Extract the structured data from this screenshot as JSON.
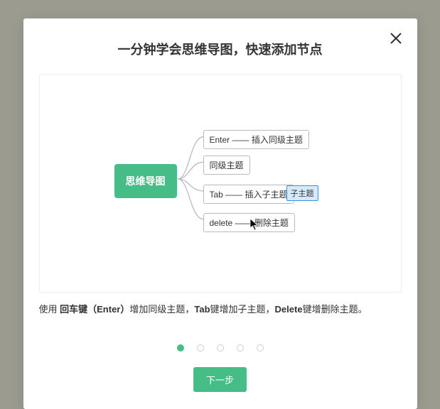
{
  "dialog": {
    "title": "一分钟学会思维导图，快速添加节点"
  },
  "mindmap": {
    "root": "思维导图",
    "children": [
      "Enter —— 插入同级主题",
      "同级主题",
      "Tab —— 插入子主题",
      "delete —— 删除主题"
    ],
    "sub": "子主题"
  },
  "caption": {
    "t1": "使用 ",
    "b1": "回车键（Enter）",
    "t2": "增加同级主题，",
    "b2": "Tab",
    "t3": "键增加子主题，",
    "b3": "Delete",
    "t4": "键增删除主题。"
  },
  "footer": {
    "next": "下一步"
  }
}
